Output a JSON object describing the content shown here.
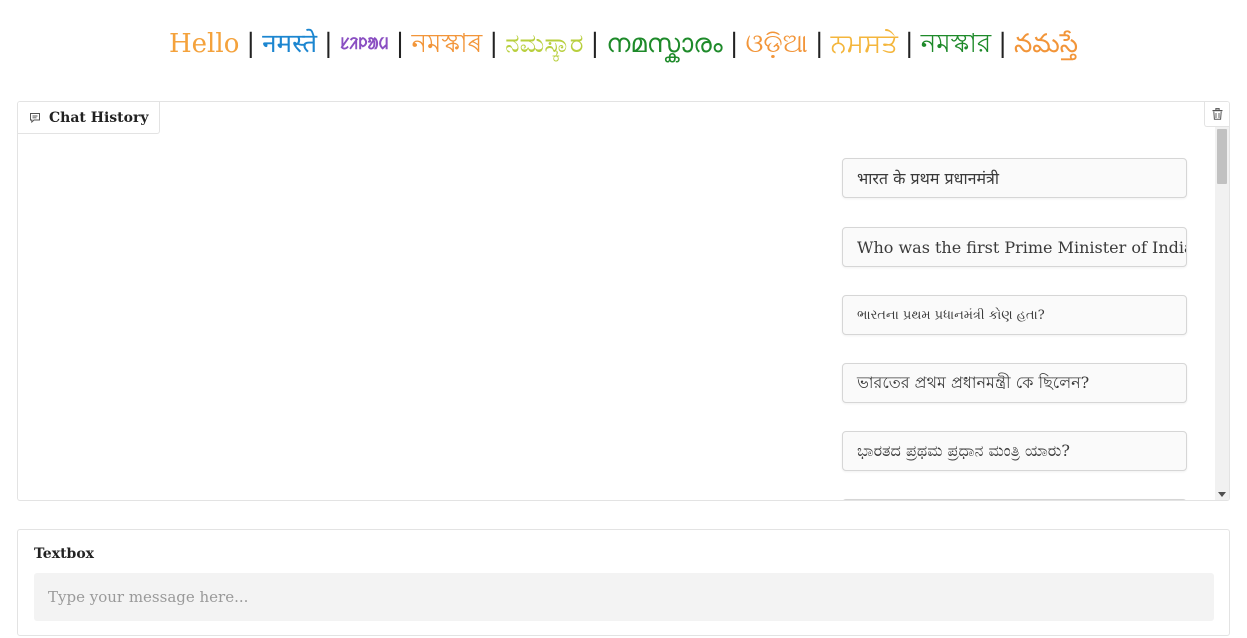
{
  "greetings": [
    {
      "text": "Hello",
      "color": "#f4a23c"
    },
    {
      "text": "नमस्ते",
      "color": "#1c86d0"
    },
    {
      "text": "ᱥᱤᱞᱟᱢ",
      "color": "#8a4fc2"
    },
    {
      "text": "নমস্কাৰ",
      "color": "#f29539"
    },
    {
      "text": "ನಮಸ್ಕಾರ",
      "color": "#b8cf3e"
    },
    {
      "text": "നമസ്കാരം",
      "color": "#1e8a2a"
    },
    {
      "text": "ଓଡ଼ିଆ",
      "color": "#f29539"
    },
    {
      "text": "ਨਮਸਤੇ",
      "color": "#f4b63c"
    },
    {
      "text": "নমস্কার",
      "color": "#1e8a2a"
    },
    {
      "text": "నమస్తే",
      "color": "#f29539"
    }
  ],
  "separator": "|",
  "chat": {
    "label": "Chat History",
    "messages": [
      "भारत के प्रथम प्रधानमंत्री",
      "Who was the first Prime Minister of India?",
      "ભારતના પ્રથમ પ્રધાનમંત્રી કોણ હતા?",
      "ভারতের প্রথম প্রধানমন্ত্রী কে ছিলেন?",
      "ಭಾರತದ ಪ್ರಥಮ ಪ್ರಧಾನ ಮಂತ್ರಿ ಯಾರು?"
    ]
  },
  "textbox": {
    "label": "Textbox",
    "placeholder": "Type your message here..."
  }
}
